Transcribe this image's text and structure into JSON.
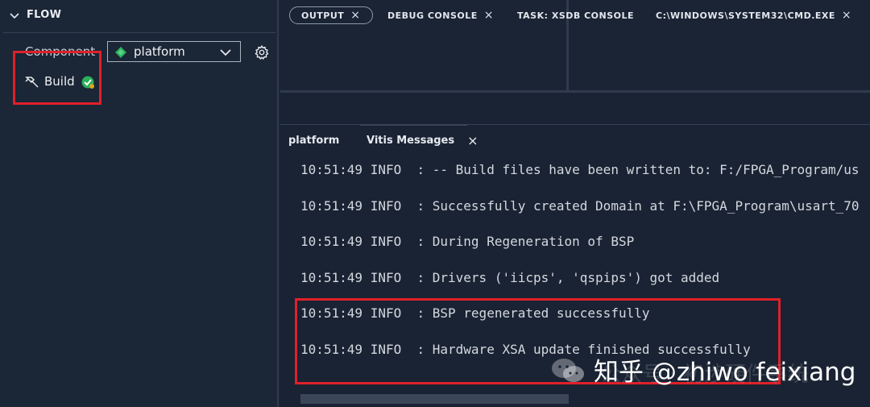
{
  "flow": {
    "title": "FLOW",
    "component_label": "Component",
    "component_value": "platform",
    "build_label": "Build"
  },
  "panel": {
    "tabs": [
      {
        "label": "OUTPUT",
        "closable": true,
        "active": true
      },
      {
        "label": "DEBUG CONSOLE",
        "closable": true,
        "active": false
      },
      {
        "label": "TASK: XSDB CONSOLE",
        "closable": false,
        "active": false
      },
      {
        "label": "C:\\WINDOWS\\SYSTEM32\\CMD.EXE",
        "closable": true,
        "active": false
      }
    ],
    "subtabs": [
      {
        "label": "platform"
      },
      {
        "label": "Vitis Messages",
        "closable": true
      }
    ],
    "log_lines": [
      "10:51:49 INFO  : -- Build files have been written to: F:/FPGA_Program/us",
      "10:51:49 INFO  : Successfully created Domain at F:\\FPGA_Program\\usart_70",
      "10:51:49 INFO  : During Regeneration of BSP",
      "10:51:49 INFO  : Drivers ('iicps', 'qspips') got added",
      "10:51:49 INFO  : BSP regenerated successfully",
      "10:51:49 INFO  : Hardware XSA update finished successfully"
    ]
  },
  "watermark": {
    "text": "知乎 @zhiwo feixiang",
    "faded": "公众号 · 初涉硬件系统"
  },
  "icons": {
    "chevron": "chevron-down-icon",
    "component": "component-diamond-icon",
    "settings": "gear-icon",
    "build": "hammer-icon",
    "build_status": "check-badge-icon"
  },
  "colors": {
    "highlight": "#e0202a",
    "success": "#2bb05a",
    "background": "#1b2535"
  }
}
